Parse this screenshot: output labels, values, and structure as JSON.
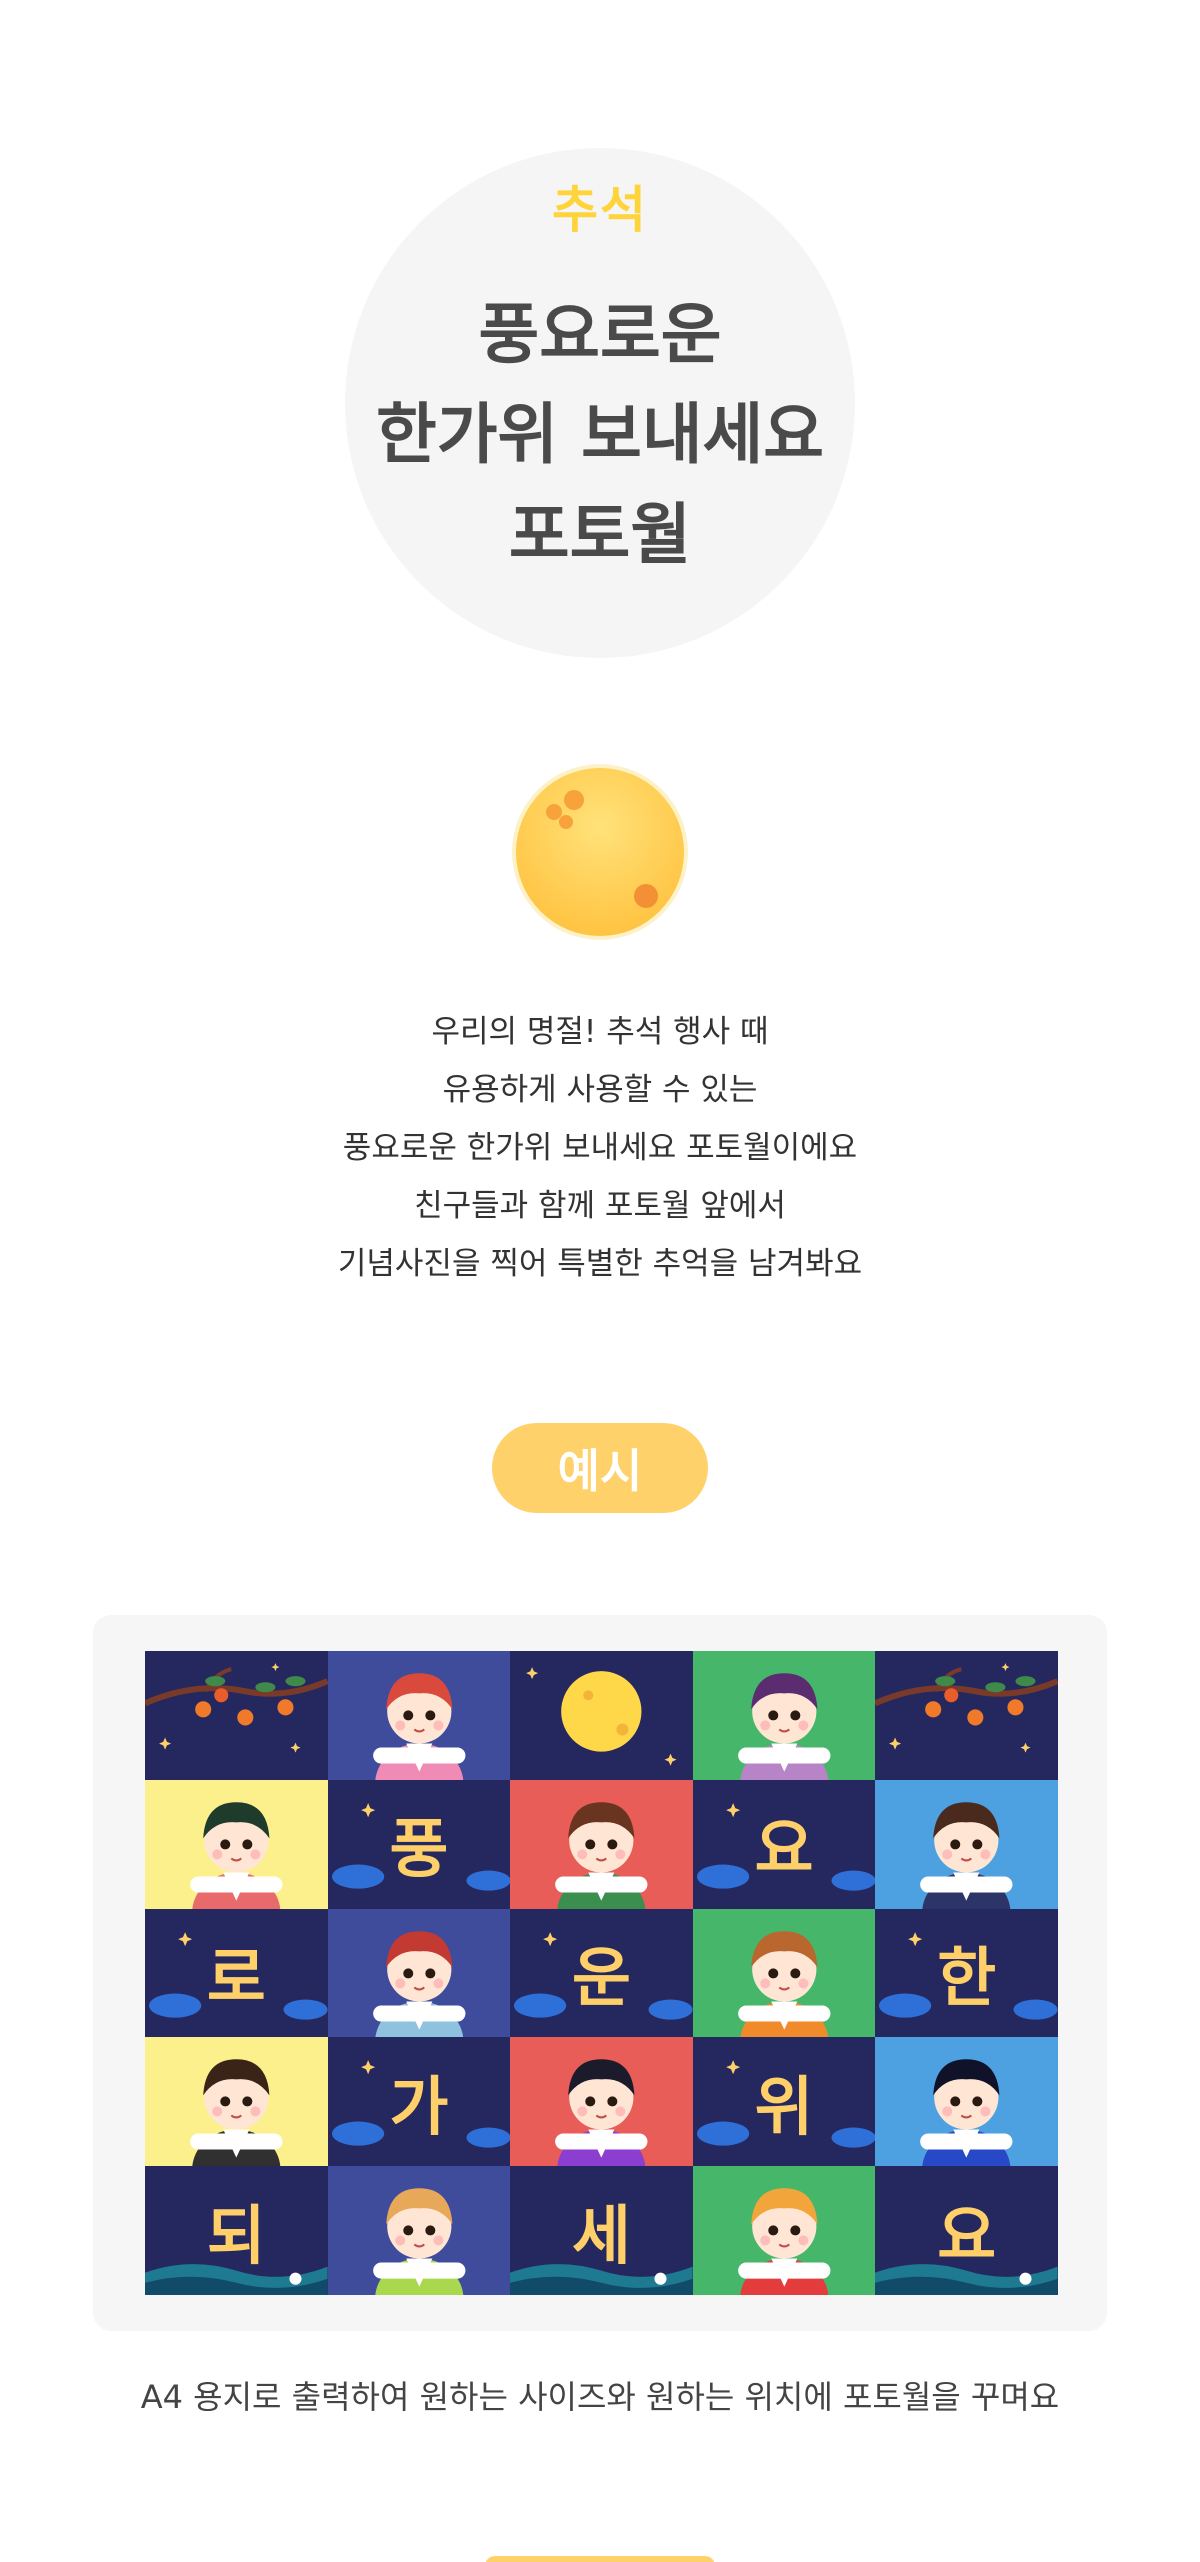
{
  "hero": {
    "kicker": "추석",
    "title_lines": [
      "풍요로운",
      "한가위 보내세요",
      "포토월"
    ]
  },
  "moon_icon": "full-moon-icon",
  "intro_lines": [
    "우리의 명절! 추석 행사 때",
    "유용하게 사용할 수 있는",
    "풍요로운 한가위 보내세요 포토월이에요",
    "친구들과 함께 포토월 앞에서",
    "기념사진을 찍어 특별한 추억을 남겨봐요"
  ],
  "example_label": "예시",
  "preview": {
    "colors": {
      "navy": "#25285f",
      "indigo": "#3f4b9b",
      "red": "#e85d57",
      "green": "#46b66a",
      "yellow": "#fbf08c",
      "sky": "#4ea1e0",
      "moon": "#ffd84a",
      "text": "#ffd06a"
    },
    "cells": [
      {
        "bg": "navy",
        "kind": "branch"
      },
      {
        "bg": "indigo",
        "kind": "child",
        "hair": "#d94a3c",
        "robe": "#f08bb6"
      },
      {
        "bg": "navy",
        "kind": "moon"
      },
      {
        "bg": "green",
        "kind": "child",
        "hair": "#5b2c6f",
        "robe": "#b784c8"
      },
      {
        "bg": "navy",
        "kind": "branch"
      },
      {
        "bg": "yellow",
        "kind": "child",
        "hair": "#1f3b2c",
        "robe": "#e86a6a"
      },
      {
        "bg": "navy",
        "kind": "syllable",
        "text": "풍"
      },
      {
        "bg": "red",
        "kind": "child",
        "hair": "#6a3520",
        "robe": "#3a8f4f"
      },
      {
        "bg": "navy",
        "kind": "syllable",
        "text": "요"
      },
      {
        "bg": "sky",
        "kind": "child",
        "hair": "#4a2a1c",
        "robe": "#2c3568"
      },
      {
        "bg": "navy",
        "kind": "syllable",
        "text": "로"
      },
      {
        "bg": "indigo",
        "kind": "child",
        "hair": "#c23a32",
        "robe": "#8fc2df"
      },
      {
        "bg": "navy",
        "kind": "syllable",
        "text": "운"
      },
      {
        "bg": "green",
        "kind": "child",
        "hair": "#b9672e",
        "robe": "#f08a2a"
      },
      {
        "bg": "navy",
        "kind": "syllable",
        "text": "한"
      },
      {
        "bg": "yellow",
        "kind": "child",
        "hair": "#3a2418",
        "robe": "#303030"
      },
      {
        "bg": "navy",
        "kind": "syllable",
        "text": "가"
      },
      {
        "bg": "red",
        "kind": "child",
        "hair": "#1b1b2b",
        "robe": "#8c3ed1"
      },
      {
        "bg": "navy",
        "kind": "syllable",
        "text": "위"
      },
      {
        "bg": "sky",
        "kind": "child",
        "hair": "#10122a",
        "robe": "#2749c8"
      },
      {
        "bg": "navy",
        "kind": "syllable",
        "text": "되"
      },
      {
        "bg": "indigo",
        "kind": "child",
        "hair": "#e7a85a",
        "robe": "#a9d84f"
      },
      {
        "bg": "navy",
        "kind": "syllable",
        "text": "세"
      },
      {
        "bg": "green",
        "kind": "child",
        "hair": "#f2a53b",
        "robe": "#e33c3c"
      },
      {
        "bg": "navy",
        "kind": "syllable",
        "text": "요"
      }
    ]
  },
  "caption": "A4 용지로 출력하여 원하는 사이즈와 원하는 위치에 포토월을 꾸며요"
}
